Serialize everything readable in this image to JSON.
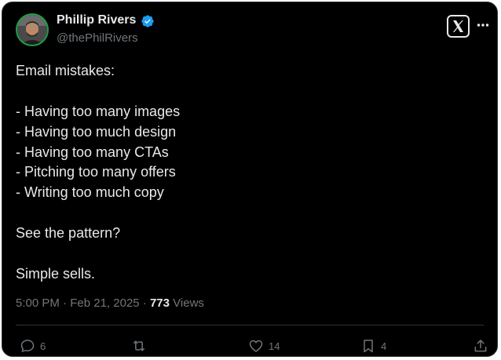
{
  "author": {
    "display_name": "Phillip Rivers",
    "handle": "@thePhilRivers",
    "verified": true,
    "avatar_ring_color": "#1d9e49",
    "verified_color": "#1d9bf0"
  },
  "tweet": {
    "lines": [
      "Email mistakes:",
      "",
      "- Having too many images",
      "- Having too much design",
      "- Having too many CTAs",
      "- Pitching too many offers",
      "- Writing too much copy",
      "",
      "See the pattern?",
      "",
      "Simple sells."
    ]
  },
  "meta": {
    "time": "5:00 PM",
    "separator": "·",
    "date": "Feb 21, 2025",
    "views_count": "773",
    "views_label": "Views"
  },
  "actions": {
    "replies": "6",
    "reposts": "",
    "likes": "14",
    "bookmarks": "4"
  },
  "icons": {
    "header": [
      "x-logo-icon",
      "more-options-icon",
      "verified-badge-icon"
    ],
    "actions": [
      "reply-icon",
      "repost-icon",
      "like-icon",
      "bookmark-icon",
      "share-icon"
    ]
  },
  "colors": {
    "background": "#000000",
    "text": "#e7e9ea",
    "muted": "#71767b",
    "border": "#2f3336"
  }
}
